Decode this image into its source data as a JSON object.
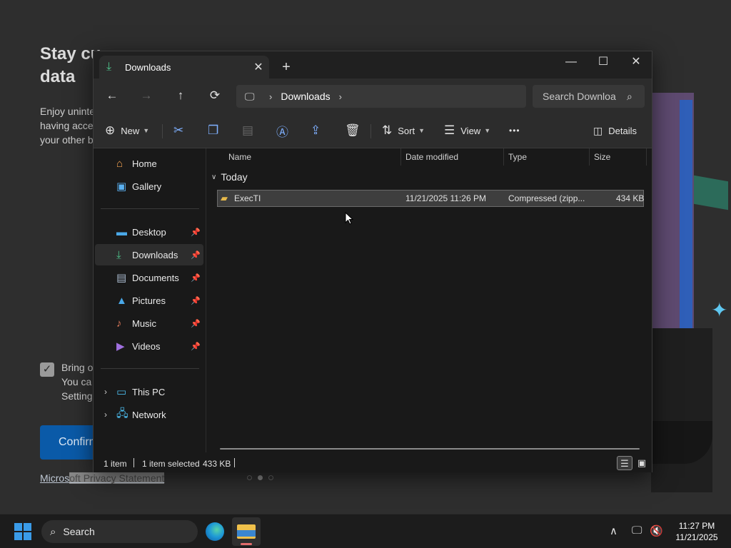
{
  "background": {
    "title": "Stay cu                t             i      data",
    "title_line1": "Stay cu",
    "title_line2": "data",
    "body_lines": [
      "Enjoy uninte",
      "having acce",
      "your other b"
    ],
    "checkbox_lines": [
      "Bring o",
      "You ca",
      "Setting"
    ],
    "confirm_label": "Confirm",
    "privacy_link": "Microsoft Privacy Statement",
    "privacy_link_a": "Micros",
    "privacy_link_b": "oft Privacy Statement"
  },
  "window": {
    "tab_label": "Downloads",
    "tab_close": "✕",
    "new_tab": "+",
    "minimize": "—",
    "maximize": "☐",
    "close": "✕"
  },
  "nav": {
    "back": "←",
    "forward": "→",
    "up": "↑",
    "refresh": "⟳",
    "breadcrumb": [
      "Downloads"
    ],
    "search_placeholder": "Search Downloa"
  },
  "toolbar": {
    "new_label": "New",
    "sort_label": "Sort",
    "view_label": "View",
    "more": "•••",
    "details_label": "Details"
  },
  "sidebar": {
    "items": [
      {
        "label": "Home",
        "icon": "home-icon"
      },
      {
        "label": "Gallery",
        "icon": "gallery-icon"
      },
      {
        "label": "Desktop",
        "icon": "desktop-icon"
      },
      {
        "label": "Downloads",
        "icon": "download-icon"
      },
      {
        "label": "Documents",
        "icon": "documents-icon"
      },
      {
        "label": "Pictures",
        "icon": "pictures-icon"
      },
      {
        "label": "Music",
        "icon": "music-icon"
      },
      {
        "label": "Videos",
        "icon": "videos-icon"
      },
      {
        "label": "This PC",
        "icon": "pc-icon"
      },
      {
        "label": "Network",
        "icon": "network-icon"
      }
    ]
  },
  "columns": [
    "Name",
    "Date modified",
    "Type",
    "Size"
  ],
  "group_label": "Today",
  "files": [
    {
      "name": "ExecTI",
      "date": "11/21/2025 11:26 PM",
      "type": "Compressed (zipp...",
      "size": "434 KB"
    }
  ],
  "status": {
    "count": "1 item",
    "selected": "1 item selected",
    "size": "433 KB"
  },
  "taskbar": {
    "search_label": "Search",
    "time": "11:27 PM",
    "date": "11/21/2025"
  },
  "colors": {
    "accent": "#3a9be8",
    "download_green": "#4ec08a",
    "folder_yellow": "#f0c14b",
    "confirm_blue": "#0a5aa8"
  }
}
